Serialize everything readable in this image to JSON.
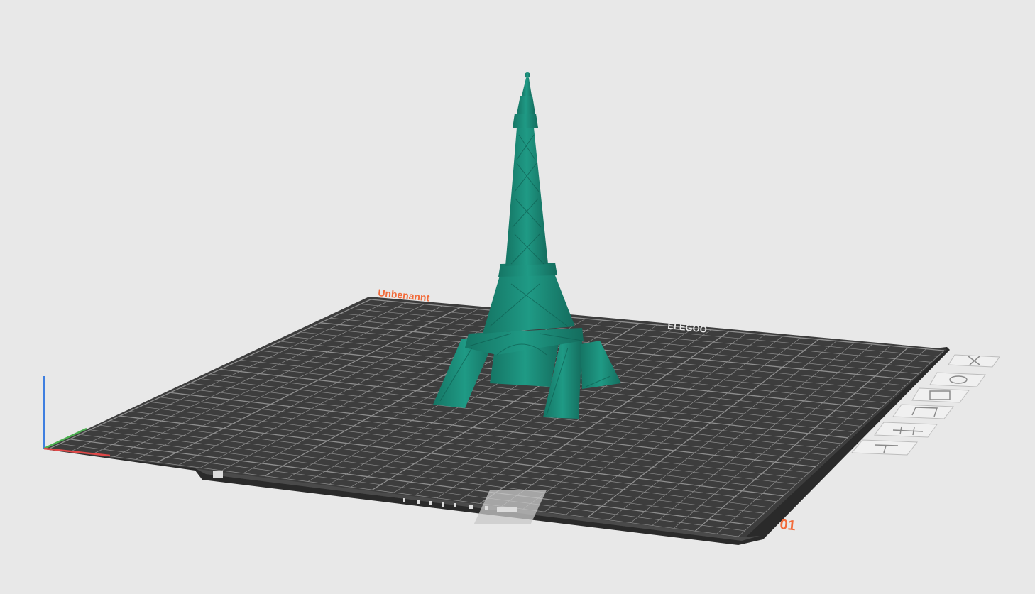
{
  "viewport": {
    "background": "#e8e8e8",
    "plate_color": "#3d3d3d",
    "grid_color": "#8f8f8f",
    "model_color": "#1a8a78",
    "accent_color": "#f26b3a"
  },
  "plate": {
    "name_label": "Unbenannt",
    "number_label": "01",
    "brand_label": "ELEGOO"
  },
  "plate_toolbar": [
    {
      "name": "close-plate-button",
      "icon": "close-icon"
    },
    {
      "name": "plate-lock-button",
      "icon": "eye-icon"
    },
    {
      "name": "plate-settings-button",
      "icon": "plate-settings-icon"
    },
    {
      "name": "auto-arrange-button",
      "icon": "arrange-icon"
    },
    {
      "name": "orient-button",
      "icon": "slider-icon"
    },
    {
      "name": "slice-plate-button",
      "icon": "upload-icon"
    }
  ],
  "axes": {
    "x_color": "#e04848",
    "y_color": "#4caf50",
    "z_color": "#3f7fe0"
  }
}
